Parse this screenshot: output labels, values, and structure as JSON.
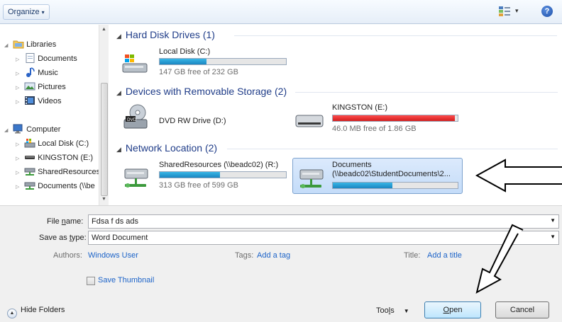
{
  "toolbar": {
    "organize_label": "Organize",
    "caret": "▾",
    "views_caret": "▾",
    "help_label": "?"
  },
  "nav": {
    "items": [
      {
        "label": "Libraries",
        "icon": "libraries-icon",
        "expanded": true
      },
      {
        "label": "Documents",
        "icon": "documents-library-icon"
      },
      {
        "label": "Music",
        "icon": "music-icon"
      },
      {
        "label": "Pictures",
        "icon": "pictures-icon"
      },
      {
        "label": "Videos",
        "icon": "videos-icon"
      },
      {
        "label": "Computer",
        "icon": "computer-icon",
        "expanded": true
      },
      {
        "label": "Local Disk (C:)",
        "icon": "local-disk-icon"
      },
      {
        "label": "KINGSTON (E:)",
        "icon": "usb-drive-icon"
      },
      {
        "label": "SharedResources",
        "icon": "network-drive-icon"
      },
      {
        "label": "Documents (\\\\be",
        "icon": "network-drive-icon"
      }
    ]
  },
  "content": {
    "groups": [
      {
        "title": "Hard Disk Drives (1)"
      },
      {
        "title": "Devices with Removable Storage (2)"
      },
      {
        "title": "Network Location (2)"
      }
    ],
    "drives": {
      "local_c": {
        "name": "Local Disk (C:)",
        "free": "147 GB free of 232 GB",
        "used_fraction": 0.37
      },
      "dvd": {
        "name": "DVD RW Drive (D:)"
      },
      "kingston": {
        "name": "KINGSTON (E:)",
        "free": "46.0 MB free of 1.86 GB",
        "used_fraction": 0.976
      },
      "shared": {
        "name": "SharedResources (\\\\beadc02) (R:)",
        "free": "313 GB free of 599 GB",
        "used_fraction": 0.48
      },
      "documents": {
        "name": "Documents",
        "path": "(\\\\beadc02\\StudentDocuments\\2...",
        "used_fraction": 0.48
      }
    }
  },
  "form": {
    "file_name_label_pre": "File ",
    "file_name_label_u": "n",
    "file_name_label_post": "ame:",
    "file_name_value": "Fdsa f ds ads",
    "save_type_label_pre": "Save as ",
    "save_type_label_u": "t",
    "save_type_label_post": "ype:",
    "save_type_value": "Word Document",
    "authors_label": "Authors:",
    "authors_value": "Windows User",
    "tags_label": "Tags:",
    "tags_value": "Add a tag",
    "title_label": "Title:",
    "title_value": "Add a title",
    "thumbnail_label": "Save Thumbnail",
    "hide_folders_label": "Hide Folders",
    "tools_pre": "Too",
    "tools_u": "l",
    "tools_post": "s",
    "open_u": "O",
    "open_post": "pen",
    "cancel_label": "Cancel"
  },
  "colors": {
    "accent_blue": "#1f3c88",
    "progress_blue": "#1b86c1",
    "progress_red": "#d11d1d",
    "link": "#1c63c8"
  }
}
